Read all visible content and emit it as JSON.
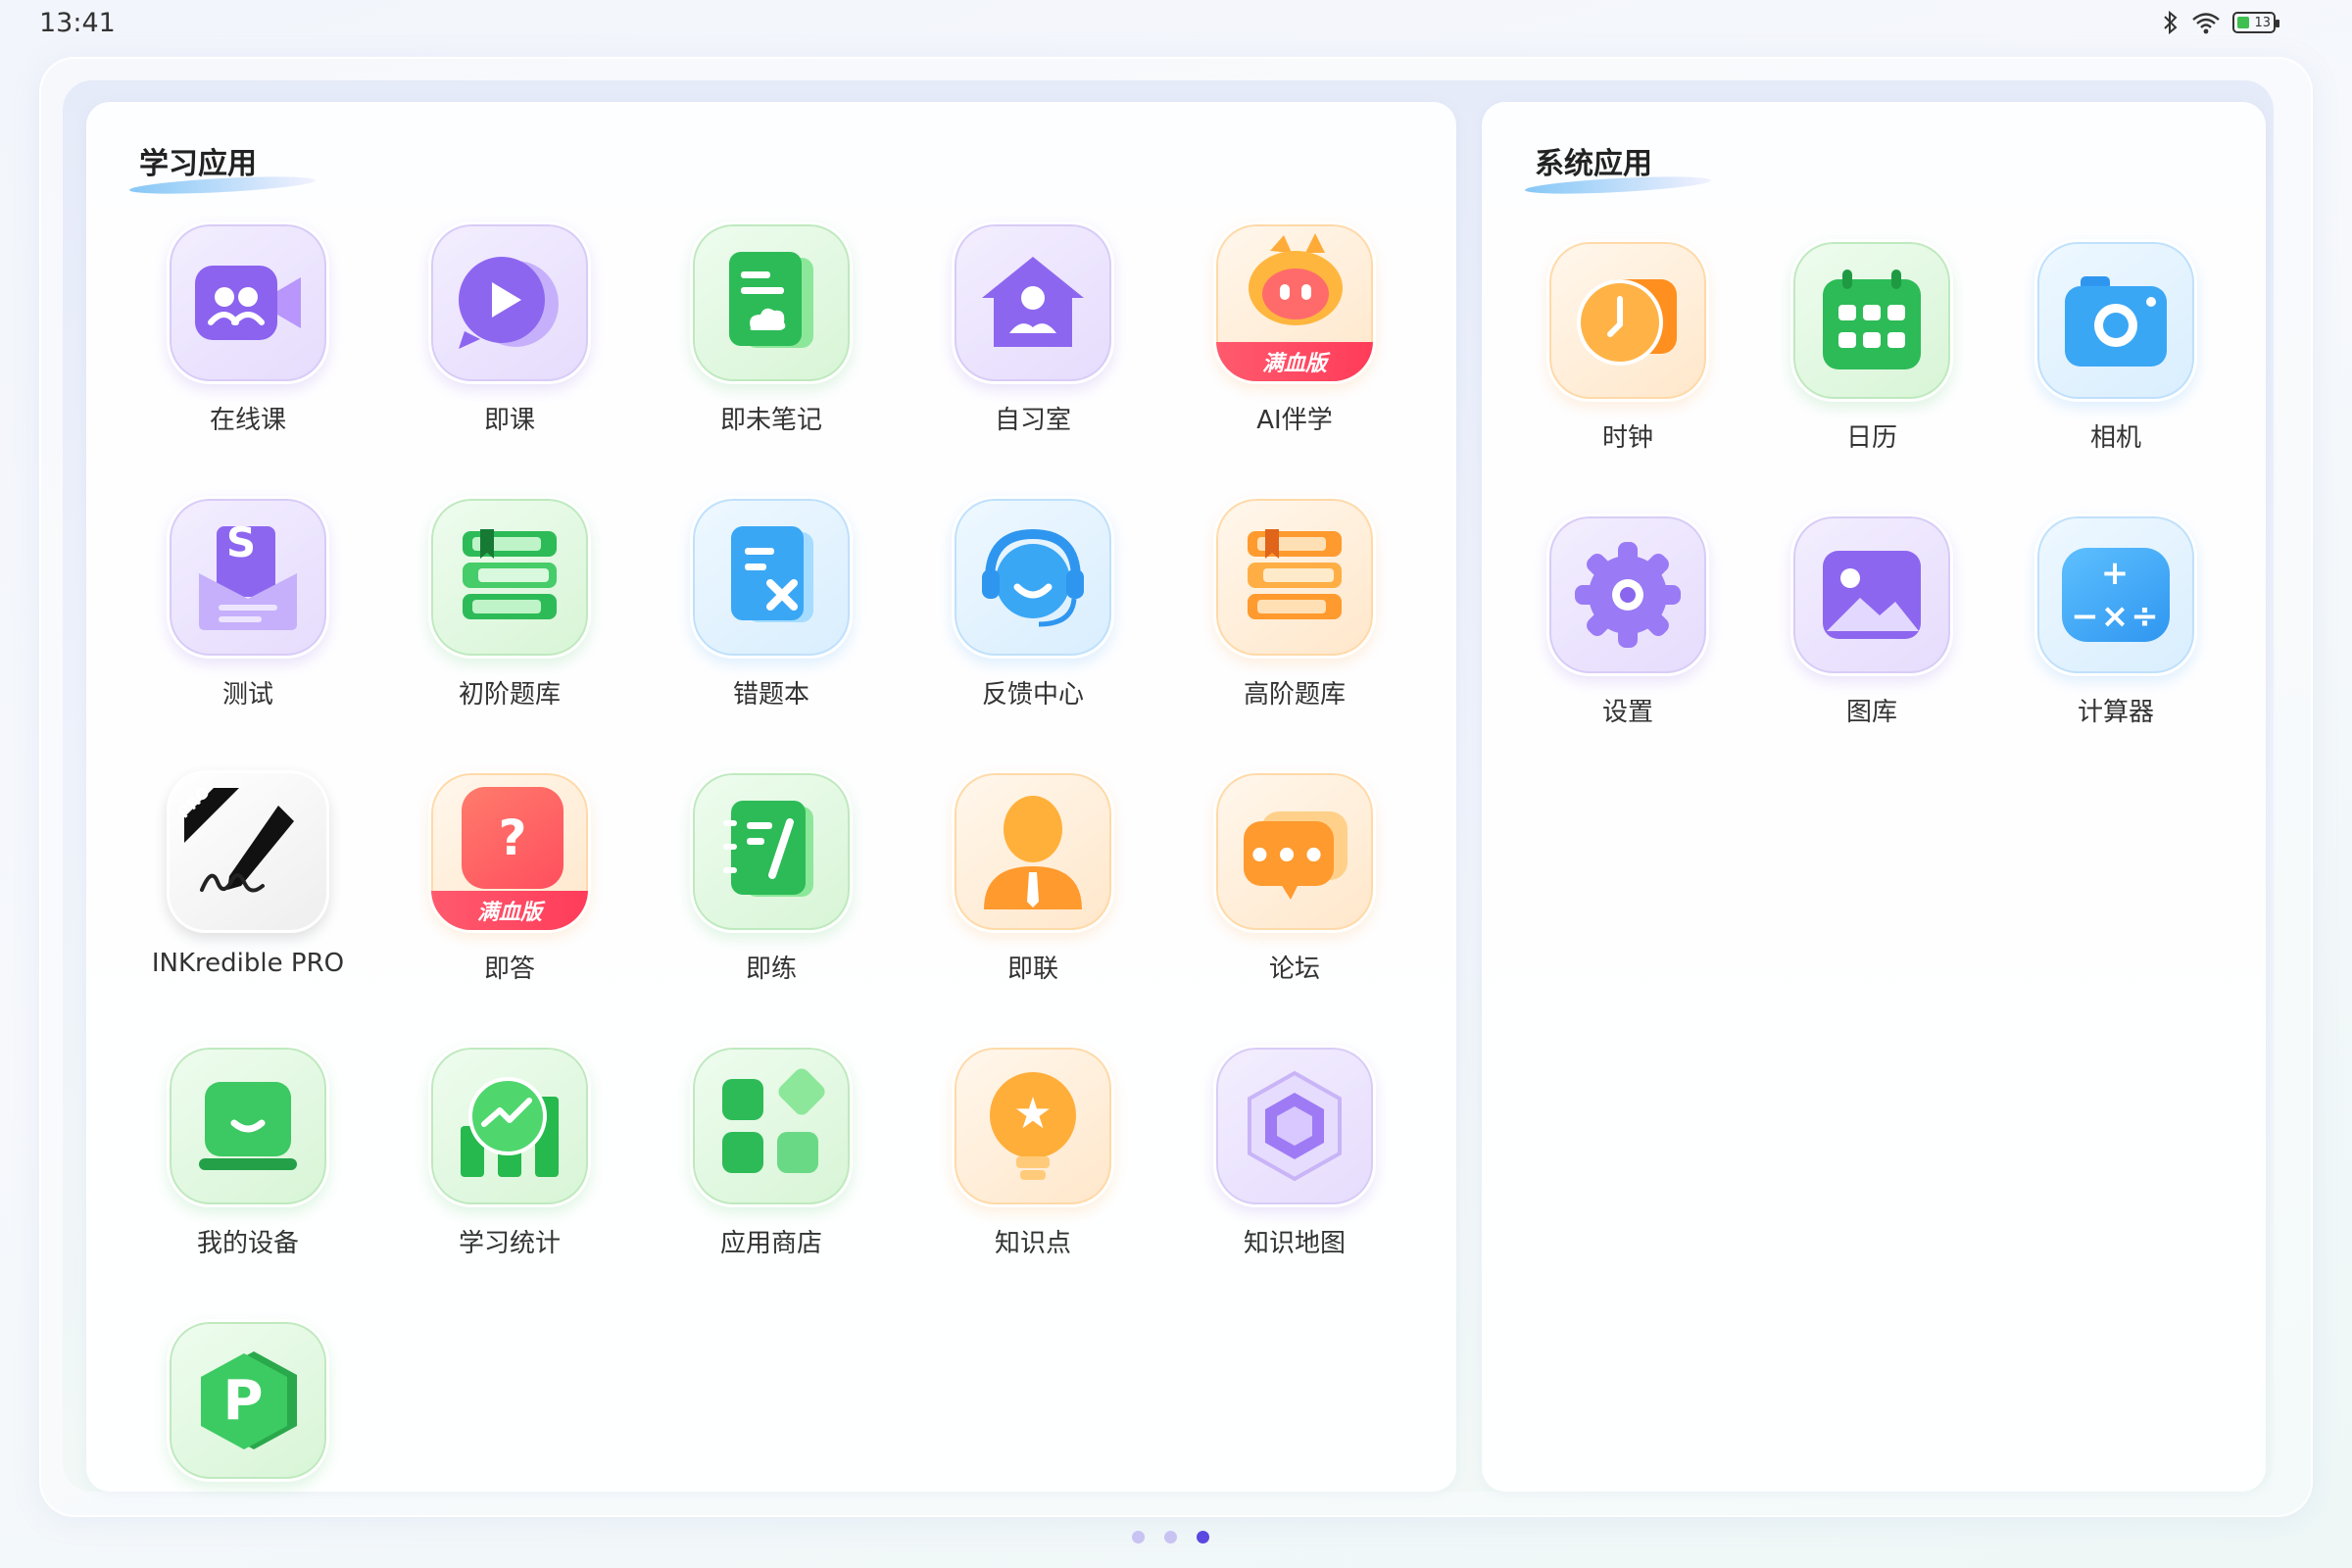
{
  "status_bar": {
    "time": "13:41",
    "battery_level": "13"
  },
  "study_section": {
    "title": "学习应用",
    "apps": [
      {
        "label": "在线课"
      },
      {
        "label": "即课"
      },
      {
        "label": "即未笔记"
      },
      {
        "label": "自习室"
      },
      {
        "label": "AI伴学",
        "banner": "满血版"
      },
      {
        "label": "测试",
        "glyph": "S"
      },
      {
        "label": "初阶题库"
      },
      {
        "label": "错题本"
      },
      {
        "label": "反馈中心"
      },
      {
        "label": "高阶题库"
      },
      {
        "label": "INKredible PRO",
        "badge": "PRO"
      },
      {
        "label": "即答",
        "glyph": "?",
        "banner": "满血版"
      },
      {
        "label": "即练"
      },
      {
        "label": "即联"
      },
      {
        "label": "论坛",
        "glyph": "•••"
      },
      {
        "label": "我的设备"
      },
      {
        "label": "学习统计"
      },
      {
        "label": "应用商店"
      },
      {
        "label": "知识点",
        "glyph": "★"
      },
      {
        "label": "知识地图"
      },
      {
        "label": "",
        "glyph": "P"
      }
    ]
  },
  "system_section": {
    "title": "系统应用",
    "apps": [
      {
        "label": "时钟"
      },
      {
        "label": "日历"
      },
      {
        "label": "相机"
      },
      {
        "label": "设置"
      },
      {
        "label": "图库"
      },
      {
        "label": "计算器",
        "glyph": "+−×÷"
      }
    ]
  },
  "pager": {
    "total": 3,
    "active": 3
  }
}
